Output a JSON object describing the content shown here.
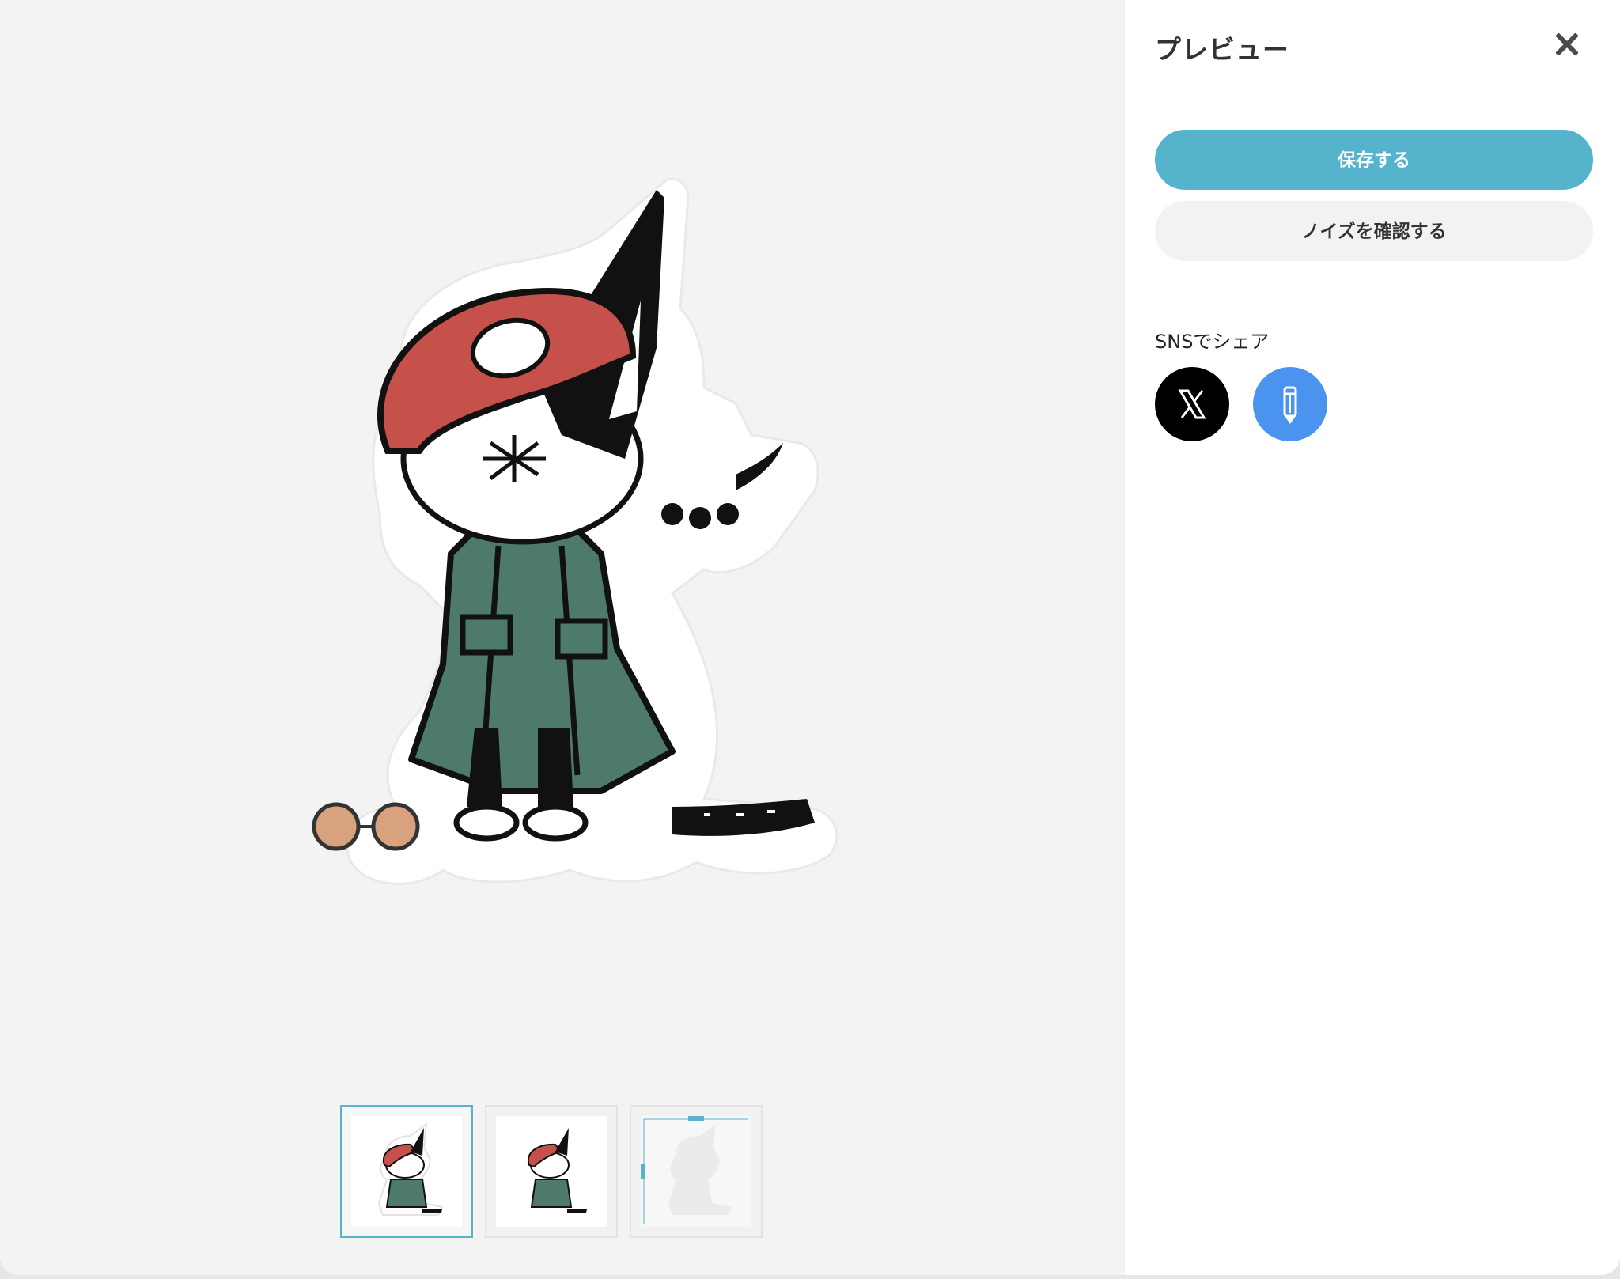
{
  "panel": {
    "title": "プレビュー",
    "close_icon": "close-icon",
    "save_label": "保存する",
    "noise_label": "ノイズを確認する",
    "share_label": "SNSでシェア",
    "share": [
      {
        "name": "x",
        "icon": "x-logo-icon",
        "color": "#000000"
      },
      {
        "name": "note",
        "icon": "pencil-icon",
        "color": "#4a94f0"
      }
    ]
  },
  "preview": {
    "background": "#f3f3f3",
    "thumbnails": [
      {
        "name": "sticker-cutout",
        "selected": true
      },
      {
        "name": "sticker-on-white",
        "selected": false
      },
      {
        "name": "sticker-size-guide",
        "selected": false
      }
    ]
  },
  "colors": {
    "accent": "#55b4cc",
    "hat": "#c6504a",
    "coat": "#4e7a6c"
  }
}
